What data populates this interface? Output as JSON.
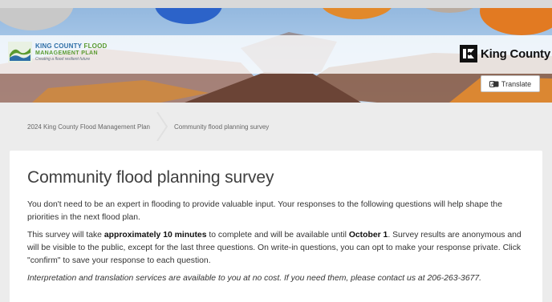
{
  "header": {
    "fmp_logo": {
      "line1_a": "KING COUNTY",
      "line1_b": "FLOOD",
      "line2": "MANAGEMENT PLAN",
      "tagline": "Creating a flood resilient future"
    },
    "kc_logo_text": "King County",
    "translate_label": "Translate",
    "translate_icon": "translate-icon"
  },
  "breadcrumb": {
    "items": [
      {
        "label": "2024 King County Flood Management Plan"
      },
      {
        "label": "Community flood planning survey"
      }
    ]
  },
  "main": {
    "title": "Community flood planning survey",
    "intro": "You don't need to be an expert in flooding to provide valuable input. Your responses to the following questions will help shape the priorities in the next flood plan.",
    "details": {
      "part1": "This survey will take ",
      "duration": "approximately 10 minutes",
      "part2": " to complete and will be available until ",
      "deadline": "October 1",
      "part3": ". Survey results are anonymous and will be visible to the public, except for the last three questions. On write-in questions, you can opt to make your response private. Click \"confirm\" to save your response to each question."
    },
    "services_note": "Interpretation and translation services are available to you at no cost. If you need them, please contact us at 206-263-3677."
  },
  "colors": {
    "fmp_blue": "#2e6fa7",
    "fmp_green": "#5a9a2f",
    "page_bg": "#ececec",
    "card_bg": "#ffffff"
  }
}
